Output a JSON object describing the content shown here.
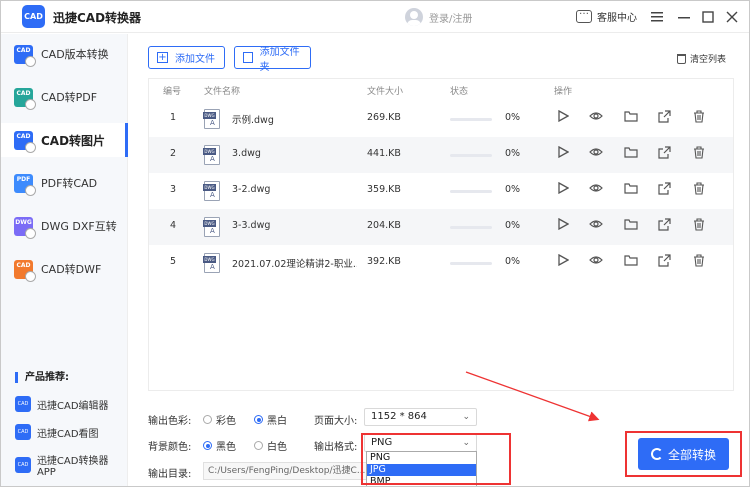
{
  "app": {
    "title": "迅捷CAD转换器",
    "logo_text": "CAD"
  },
  "header": {
    "login_text": "登录/注册",
    "service_text": "客服中心"
  },
  "sidebar": {
    "items": [
      {
        "label": "CAD版本转换",
        "icon": "CAD",
        "color": "#2e6cf6"
      },
      {
        "label": "CAD转PDF",
        "icon": "CAD",
        "color": "#26a69a"
      },
      {
        "label": "CAD转图片",
        "icon": "CAD",
        "color": "#2e6cf6"
      },
      {
        "label": "PDF转CAD",
        "icon": "PDF",
        "color": "#3d8bfd"
      },
      {
        "label": "DWG DXF互转",
        "icon": "DWG",
        "color": "#7b6cf6"
      },
      {
        "label": "CAD转DWF",
        "icon": "CAD",
        "color": "#f27a2e"
      }
    ],
    "recommend_title": "产品推荐:",
    "recommend": [
      {
        "label": "迅捷CAD编辑器"
      },
      {
        "label": "迅捷CAD看图"
      },
      {
        "label": "迅捷CAD转换器APP"
      }
    ]
  },
  "toolbar": {
    "add_file": "添加文件",
    "add_folder": "添加文件夹",
    "clear_list": "清空列表"
  },
  "table": {
    "headers": {
      "index": "编号",
      "name": "文件名称",
      "size": "文件大小",
      "status": "状态",
      "action": "操作"
    },
    "rows": [
      {
        "index": "1",
        "name": "示例.dwg",
        "size": "269.KB",
        "progress": "0%",
        "progress_value": 0
      },
      {
        "index": "2",
        "name": "3.dwg",
        "size": "441.KB",
        "progress": "0%",
        "progress_value": 0
      },
      {
        "index": "3",
        "name": "3-2.dwg",
        "size": "359.KB",
        "progress": "0%",
        "progress_value": 0
      },
      {
        "index": "4",
        "name": "3-3.dwg",
        "size": "204.KB",
        "progress": "0%",
        "progress_value": 0
      },
      {
        "index": "5",
        "name": "2021.07.02理论精讲2-职业...",
        "size": "392.KB",
        "progress": "0%",
        "progress_value": 0
      }
    ]
  },
  "options": {
    "color_label": "输出色彩:",
    "color_opts": [
      "彩色",
      "黑白"
    ],
    "color_selected": 1,
    "bg_label": "背景颜色:",
    "bg_opts": [
      "黑色",
      "白色"
    ],
    "bg_selected": 0,
    "page_size_label": "页面大小:",
    "page_size_value": "1152 * 864",
    "format_label": "输出格式:",
    "format_value": "PNG",
    "format_options": [
      "PNG",
      "JPG",
      "BMP"
    ],
    "format_highlighted": "JPG",
    "output_dir_label": "输出目录:",
    "output_dir_value": "C:/Users/FengPing/Desktop/迅捷C..."
  },
  "convert_button": "全部转换",
  "colors": {
    "accent": "#2e6cf6",
    "annotation": "#e33333"
  }
}
